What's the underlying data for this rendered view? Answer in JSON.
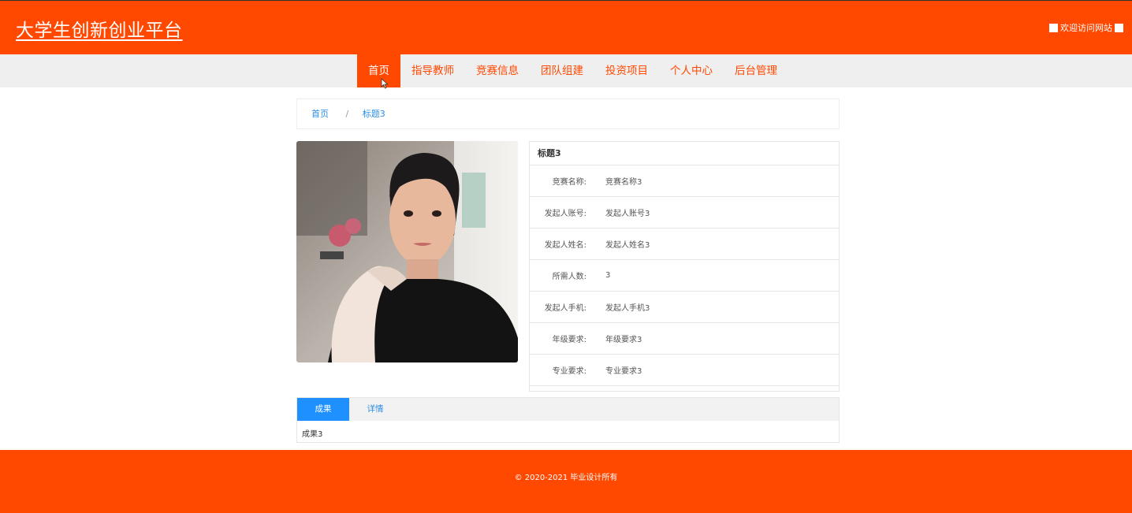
{
  "header": {
    "site_title": "大学生创新创业平台",
    "welcome_text": "欢迎访问网站"
  },
  "nav": {
    "items": [
      {
        "label": "首页",
        "active": true
      },
      {
        "label": "指导教师"
      },
      {
        "label": "竞赛信息"
      },
      {
        "label": "团队组建"
      },
      {
        "label": "投资项目"
      },
      {
        "label": "个人中心"
      },
      {
        "label": "后台管理"
      }
    ]
  },
  "breadcrumb": {
    "home": "首页",
    "separator": "/",
    "current": "标题3"
  },
  "detail": {
    "title": "标题3",
    "fields": [
      {
        "label": "竞赛名称:",
        "value": "竞赛名称3"
      },
      {
        "label": "发起人账号:",
        "value": "发起人账号3"
      },
      {
        "label": "发起人姓名:",
        "value": "发起人姓名3"
      },
      {
        "label": "所需人数:",
        "value": "3"
      },
      {
        "label": "发起人手机:",
        "value": "发起人手机3"
      },
      {
        "label": "年级要求:",
        "value": "年级要求3"
      },
      {
        "label": "专业要求:",
        "value": "专业要求3"
      }
    ]
  },
  "tabs": {
    "items": [
      {
        "label": "成果",
        "active": true
      },
      {
        "label": "详情"
      }
    ],
    "content": "成果3"
  },
  "footer": {
    "copyright": "© 2020-2021 毕业设计所有"
  },
  "colors": {
    "brand": "#ff4800",
    "tab_active": "#1e90ff",
    "link": "#2a8ee6"
  }
}
